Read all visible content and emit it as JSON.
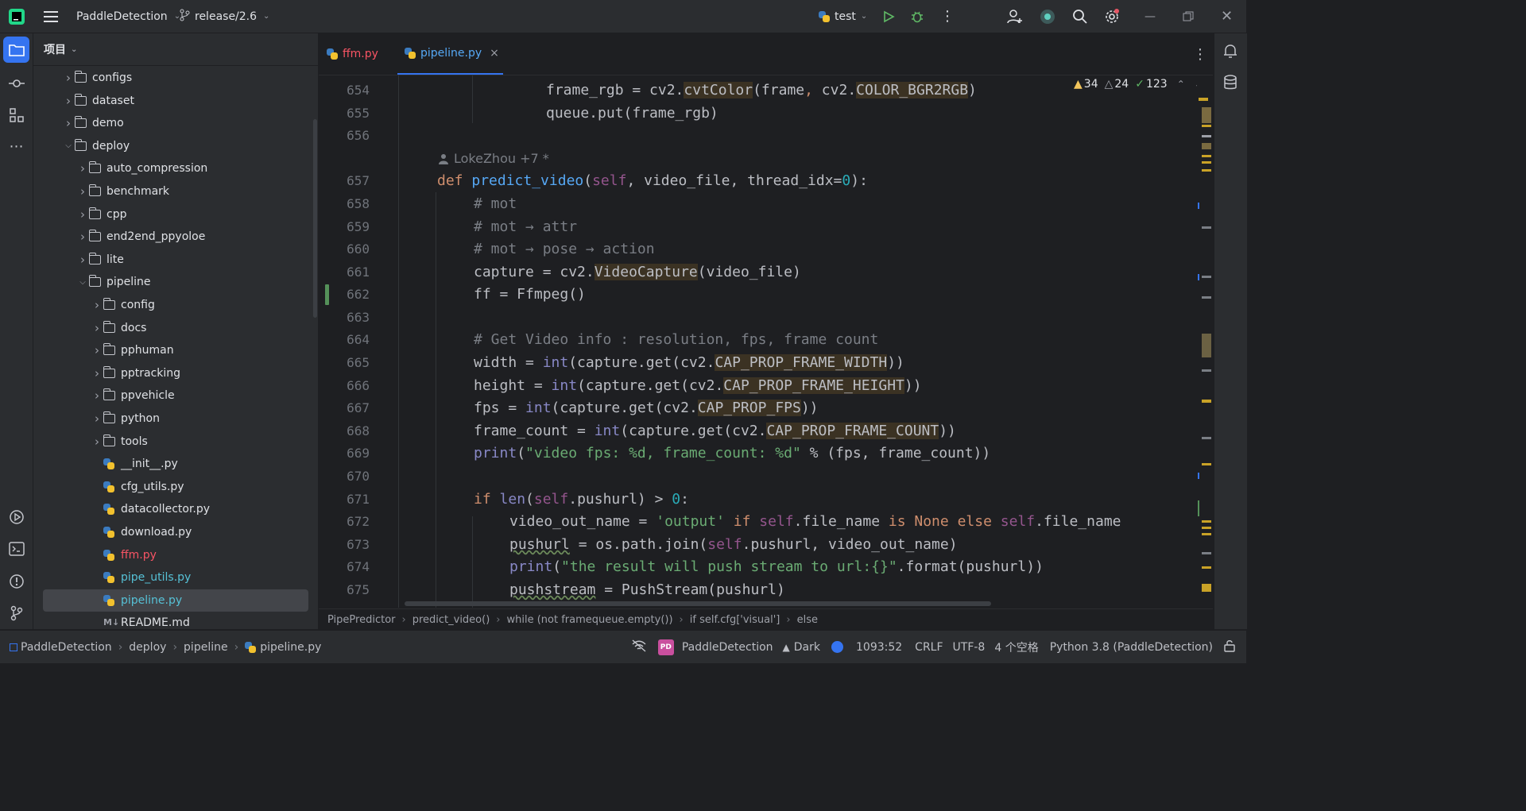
{
  "titlebar": {
    "project": "PaddleDetection",
    "branch": "release/2.6",
    "run_config": "test"
  },
  "project_panel": {
    "title": "项目",
    "items": [
      {
        "label": "configs",
        "type": "folder",
        "depth": 1,
        "expanded": false
      },
      {
        "label": "dataset",
        "type": "folder",
        "depth": 1,
        "expanded": false
      },
      {
        "label": "demo",
        "type": "folder",
        "depth": 1,
        "expanded": false
      },
      {
        "label": "deploy",
        "type": "folder",
        "depth": 1,
        "expanded": true
      },
      {
        "label": "auto_compression",
        "type": "folder",
        "depth": 2,
        "expanded": false
      },
      {
        "label": "benchmark",
        "type": "folder",
        "depth": 2,
        "expanded": false
      },
      {
        "label": "cpp",
        "type": "folder",
        "depth": 2,
        "expanded": false
      },
      {
        "label": "end2end_ppyoloe",
        "type": "folder",
        "depth": 2,
        "expanded": false
      },
      {
        "label": "lite",
        "type": "folder",
        "depth": 2,
        "expanded": false
      },
      {
        "label": "pipeline",
        "type": "folder",
        "depth": 2,
        "expanded": true
      },
      {
        "label": "config",
        "type": "folder",
        "depth": 3,
        "expanded": false
      },
      {
        "label": "docs",
        "type": "folder",
        "depth": 3,
        "expanded": false
      },
      {
        "label": "pphuman",
        "type": "folder",
        "depth": 3,
        "expanded": false
      },
      {
        "label": "pptracking",
        "type": "folder",
        "depth": 3,
        "expanded": false
      },
      {
        "label": "ppvehicle",
        "type": "folder",
        "depth": 3,
        "expanded": false
      },
      {
        "label": "python",
        "type": "folder",
        "depth": 3,
        "expanded": false
      },
      {
        "label": "tools",
        "type": "folder",
        "depth": 3,
        "expanded": false
      },
      {
        "label": "__init__.py",
        "type": "py",
        "depth": 3
      },
      {
        "label": "cfg_utils.py",
        "type": "py",
        "depth": 3
      },
      {
        "label": "datacollector.py",
        "type": "py",
        "depth": 3
      },
      {
        "label": "download.py",
        "type": "py",
        "depth": 3
      },
      {
        "label": "ffm.py",
        "type": "py",
        "depth": 3,
        "color": "#f75464"
      },
      {
        "label": "pipe_utils.py",
        "type": "py",
        "depth": 3,
        "color": "#56c1d6"
      },
      {
        "label": "pipeline.py",
        "type": "py",
        "depth": 3,
        "color": "#56c1d6",
        "selected": true
      },
      {
        "label": "README.md",
        "type": "md",
        "depth": 3
      }
    ]
  },
  "tabs": [
    {
      "label": "ffm.py",
      "color": "#f75464",
      "active": false
    },
    {
      "label": "pipeline.py",
      "color": "#56a8f5",
      "active": true,
      "close": "×"
    }
  ],
  "inspections": {
    "warnings": "34",
    "weak_warnings": "24",
    "typos": "123"
  },
  "author_hint": "LokeZhou +7 *",
  "line_numbers": [
    "654",
    "655",
    "656",
    "657",
    "658",
    "659",
    "660",
    "661",
    "662",
    "663",
    "664",
    "665",
    "666",
    "667",
    "668",
    "669",
    "670",
    "671",
    "672",
    "673",
    "674",
    "675"
  ],
  "breadcrumb": [
    "PipePredictor",
    "predict_video()",
    "while (not framequeue.empty())",
    "if self.cfg['visual']",
    "else"
  ],
  "statusbar": {
    "path": [
      "PaddleDetection",
      "deploy",
      "pipeline",
      "pipeline.py"
    ],
    "project_badge": "PD",
    "project": "PaddleDetection",
    "theme": "Dark",
    "position": "1093:52",
    "line_sep": "CRLF",
    "encoding": "UTF-8",
    "indent": "4 个空格",
    "interpreter": "Python 3.8 (PaddleDetection)"
  },
  "colors": {
    "bg": "#1e1f22",
    "panel": "#2b2d30",
    "accent": "#3574f0",
    "keyword": "#cf8e6d",
    "function": "#56a8f5",
    "string": "#6aab73",
    "comment": "#7a7e85",
    "self": "#94558d",
    "number": "#2aacb8"
  }
}
